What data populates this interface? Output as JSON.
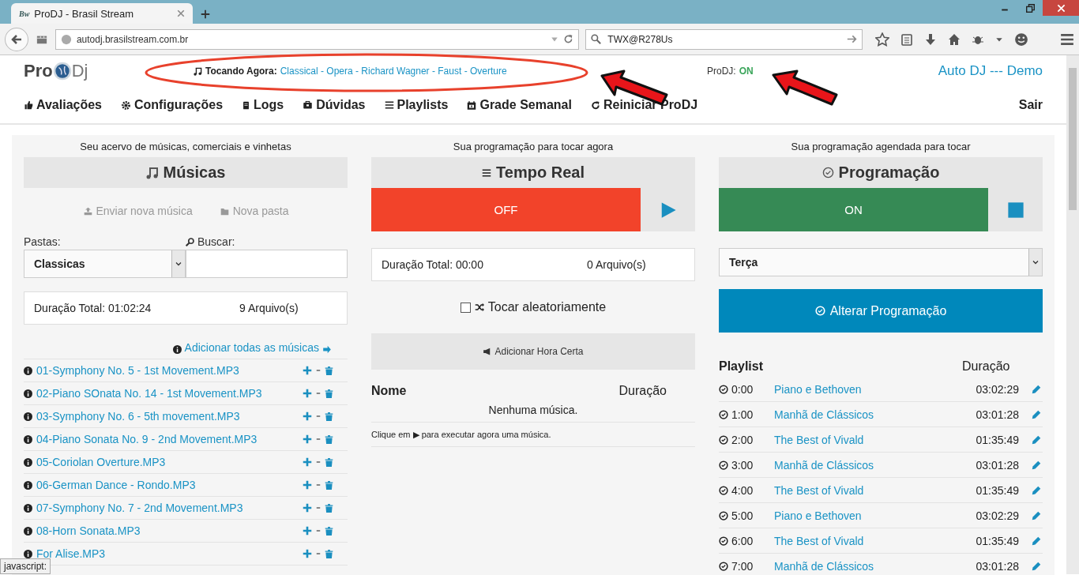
{
  "browser": {
    "favicon": "Bw",
    "tab_title": "ProDJ - Brasil Stream",
    "url": "autodj.brasilstream.com.br",
    "search": "TWX@R278Us",
    "status_text": "javascript:"
  },
  "header": {
    "logo_left": "Pro",
    "logo_right": "Dj",
    "now_playing_label": "Tocando Agora:",
    "now_playing": "Classical - Opera - Richard Wagner - Faust - Overture",
    "status_label": "ProDJ:",
    "status_value": "ON",
    "status_on": true,
    "title": "Auto DJ --- Demo"
  },
  "nav": [
    {
      "label": "Avaliações"
    },
    {
      "label": "Configurações"
    },
    {
      "label": "Logs"
    },
    {
      "label": "Dúvidas"
    },
    {
      "label": "Playlists"
    },
    {
      "label": "Grade Semanal"
    },
    {
      "label": "Reiniciar ProDJ"
    }
  ],
  "logout": "Sair",
  "library": {
    "caption": "Seu acervo de músicas, comerciais e vinhetas",
    "title": "Músicas",
    "upload": "Enviar nova música",
    "new_folder": "Nova pasta",
    "folder_label": "Pastas:",
    "folder": "Classicas",
    "search_label": "Buscar:",
    "total": "Duração Total: 01:02:24",
    "count": "9 Arquivo(s)",
    "add_all": "Adicionar todas as músicas",
    "songs": [
      {
        "name": "01-Symphony No. 5 - 1st Movement.MP3"
      },
      {
        "name": "02-Piano SOnata No. 14 - 1st Movement.MP3"
      },
      {
        "name": "03-Symphony No. 6 - 5th movement.MP3"
      },
      {
        "name": "04-Piano Sonata No. 9 - 2nd Movement.MP3"
      },
      {
        "name": "05-Coriolan Overture.MP3"
      },
      {
        "name": "06-German Dance - Rondo.MP3"
      },
      {
        "name": "07-Symphony No. 7 - 2nd Movement.MP3"
      },
      {
        "name": "08-Horn Sonata.MP3"
      },
      {
        "name": "For Alise.MP3"
      }
    ]
  },
  "realtime": {
    "caption": "Sua programação para tocar agora",
    "title": "Tempo Real",
    "power": "OFF",
    "on": false,
    "total": "Duração Total: 00:00",
    "count": "0 Arquivo(s)",
    "shuffle": {
      "label": "Tocar aleatoriamente",
      "checked": false
    },
    "hora_certa": "Adicionar Hora Certa",
    "columns": [
      "Nome",
      "Duração"
    ],
    "empty": "Nenhuma música.",
    "hint": "Clique em ▶ para executar agora uma música."
  },
  "schedule": {
    "caption": "Sua programação agendada para tocar",
    "title": "Programação",
    "power": "ON",
    "on": true,
    "day": "Terça",
    "button": "Alterar Programação",
    "columns": [
      "Playlist",
      "Duração"
    ],
    "rows": [
      {
        "time": "0:00",
        "name": "Piano e Bethoven",
        "duration": "03:02:29"
      },
      {
        "time": "1:00",
        "name": "Manhã de Clássicos",
        "duration": "03:01:28"
      },
      {
        "time": "2:00",
        "name": "The Best of Vivald",
        "duration": "01:35:49"
      },
      {
        "time": "3:00",
        "name": "Manhã de Clássicos",
        "duration": "03:01:28"
      },
      {
        "time": "4:00",
        "name": "The Best of Vivald",
        "duration": "01:35:49"
      },
      {
        "time": "5:00",
        "name": "Piano e Bethoven",
        "duration": "03:02:29"
      },
      {
        "time": "6:00",
        "name": "The Best of Vivald",
        "duration": "01:35:49"
      },
      {
        "time": "7:00",
        "name": "Manhã de Clássicos",
        "duration": "03:01:28"
      }
    ]
  }
}
